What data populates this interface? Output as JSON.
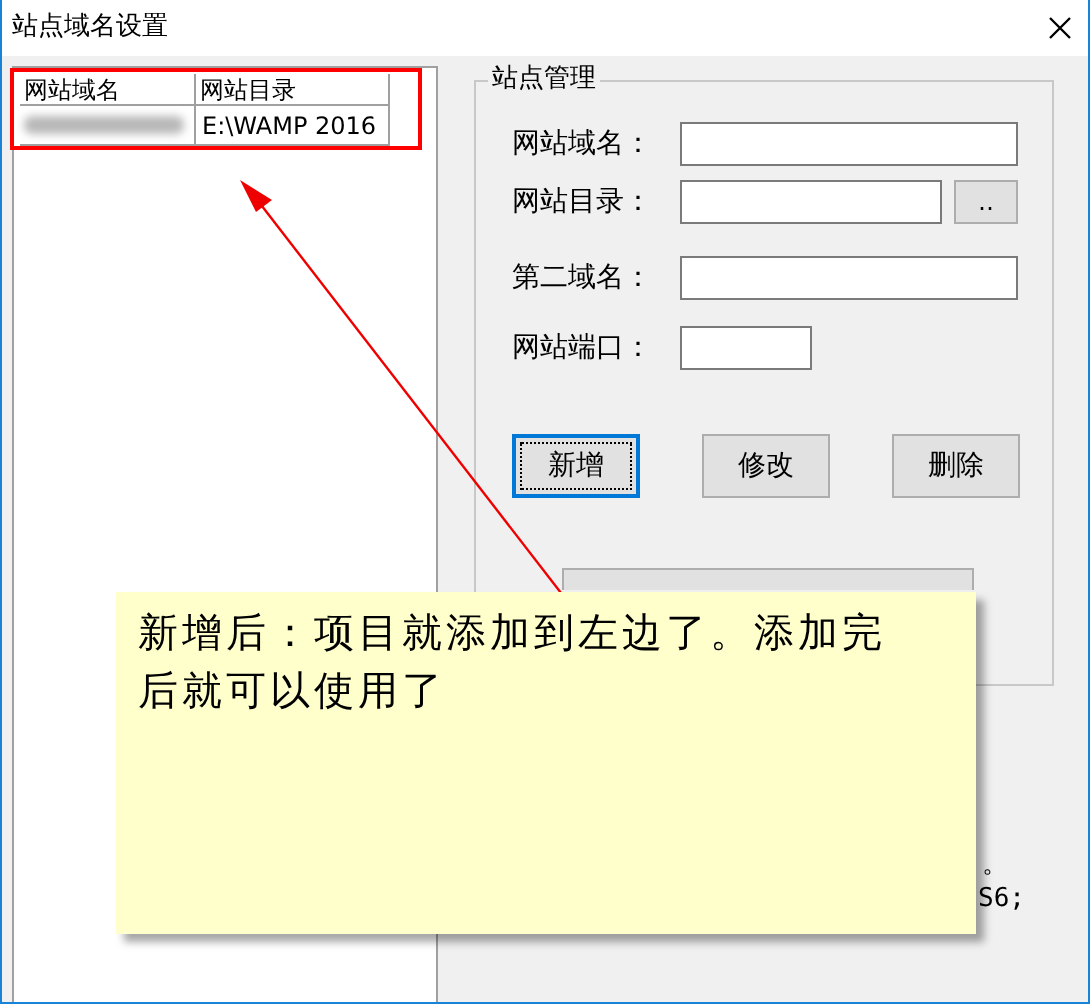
{
  "window": {
    "title": "站点域名设置"
  },
  "site_list": {
    "columns": [
      "网站域名",
      "网站目录"
    ],
    "rows": [
      {
        "domain_blurred": true,
        "directory": "E:\\WAMP 2016"
      }
    ]
  },
  "site_management": {
    "title": "站点管理",
    "fields": [
      {
        "label": "网站域名：",
        "kind": "text"
      },
      {
        "label": "网站目录：",
        "kind": "browse",
        "button": "‥"
      },
      {
        "label": "第二域名：",
        "kind": "text"
      },
      {
        "label": "网站端口：",
        "kind": "short"
      }
    ],
    "buttons": [
      {
        "label": "新增",
        "focused": true
      },
      {
        "label": "修改",
        "focused": false
      },
      {
        "label": "删除",
        "focused": false
      }
    ]
  },
  "hint_fragments": [
    "。",
    "S6;"
  ],
  "annotation": {
    "note": "新增后：项目就添加到左边了。添加完后就可以使用了"
  }
}
